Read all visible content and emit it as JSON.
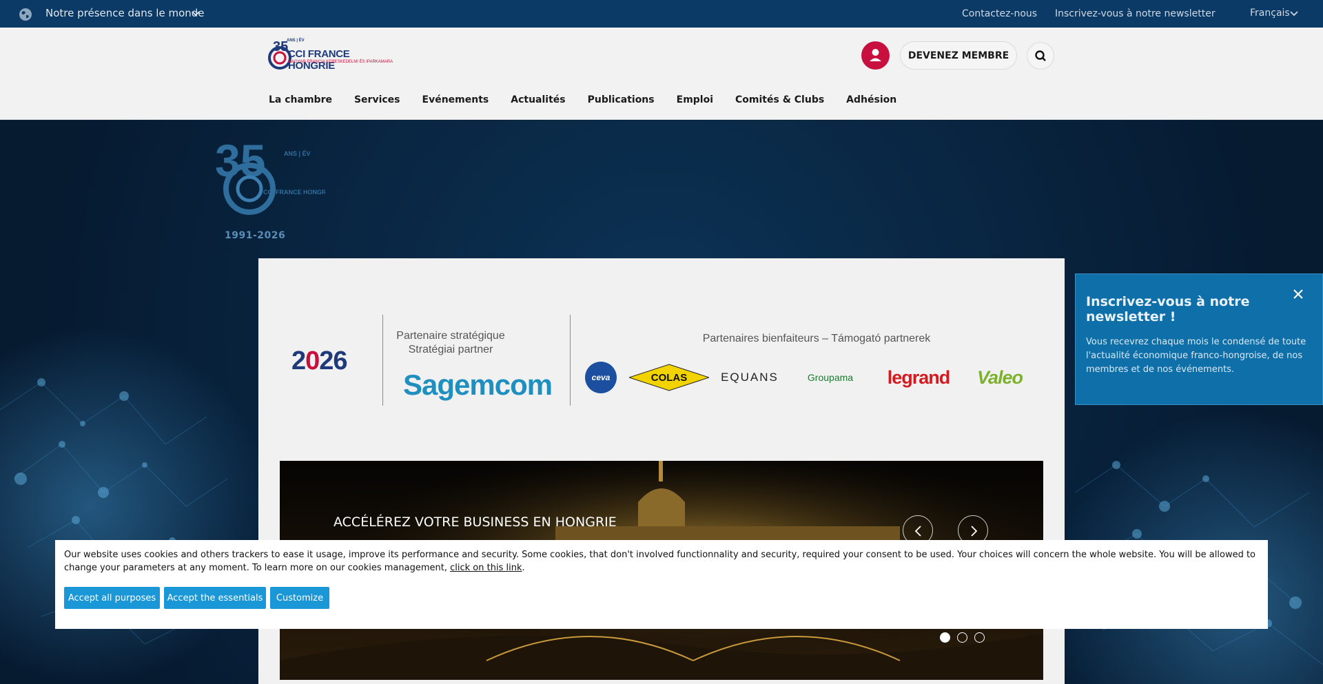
{
  "topbar": {
    "world_label": "Notre présence dans le monde",
    "contact": "Contactez-nous",
    "newsletter": "Inscrivez-vous à notre newsletter",
    "language": "Français"
  },
  "header": {
    "logo_text": "CCI FRANCE HONGRIE",
    "logo_sub": "MAGYAR-FRANCIA KERESKEDELMI ÉS IPARKAMARA",
    "logo_ans": "ANS | ÉV",
    "member_button": "DEVENEZ MEMBRE",
    "nav": [
      "La chambre",
      "Services",
      "Evénements",
      "Actualités",
      "Publications",
      "Emploi",
      "Comités & Clubs",
      "Adhésion"
    ]
  },
  "hero": {
    "badge_number": "35",
    "badge_ans": "ANS | ÉV",
    "badge_name": "CCI FRANCE HONGRIE",
    "badge_years": "1991-2026"
  },
  "partners": {
    "year_main": "2026",
    "strategic_line1": "Partenaire stratégique",
    "strategic_line2": "Stratégiai partner",
    "strategic_partner": "Sagemcom",
    "benefactors_title": "Partenaires bienfaiteurs – Támogató partnerek",
    "logos": [
      "ceva",
      "COLAS",
      "EQUANS",
      "Groupama",
      "legrand",
      "Valeo"
    ]
  },
  "slider": {
    "title": "ACCÉLÉREZ VOTRE BUSINESS EN HONGRIE",
    "dots": 3,
    "active_dot": 1
  },
  "newsletter_popup": {
    "title": "Inscrivez-vous à notre newsletter !",
    "text": "Vous recevrez chaque mois le condensé de toute l'actualité économique franco-hongroise, de nos membres et de nos événements."
  },
  "cookie": {
    "text": "Our website uses cookies and others trackers to ease it usage, improve its performance and security. Some cookies, that don't involved functionnality and security, required your consent to be used. Your choices will concern the whole website. You will be allowed to change your parameters at any moment. To learn more on our cookies management, ",
    "link": "click on this link",
    "after_link": ".",
    "accept_all": "Accept all purposes",
    "accept_essentials": "Accept the essentials",
    "customize": "Customize"
  },
  "colors": {
    "topbar": "#0b3a66",
    "brand_red": "#c8103e",
    "brand_blue": "#1e3a7a",
    "cookie_button": "#1a97d6",
    "newsletter_bg": "#0f6fa8"
  }
}
